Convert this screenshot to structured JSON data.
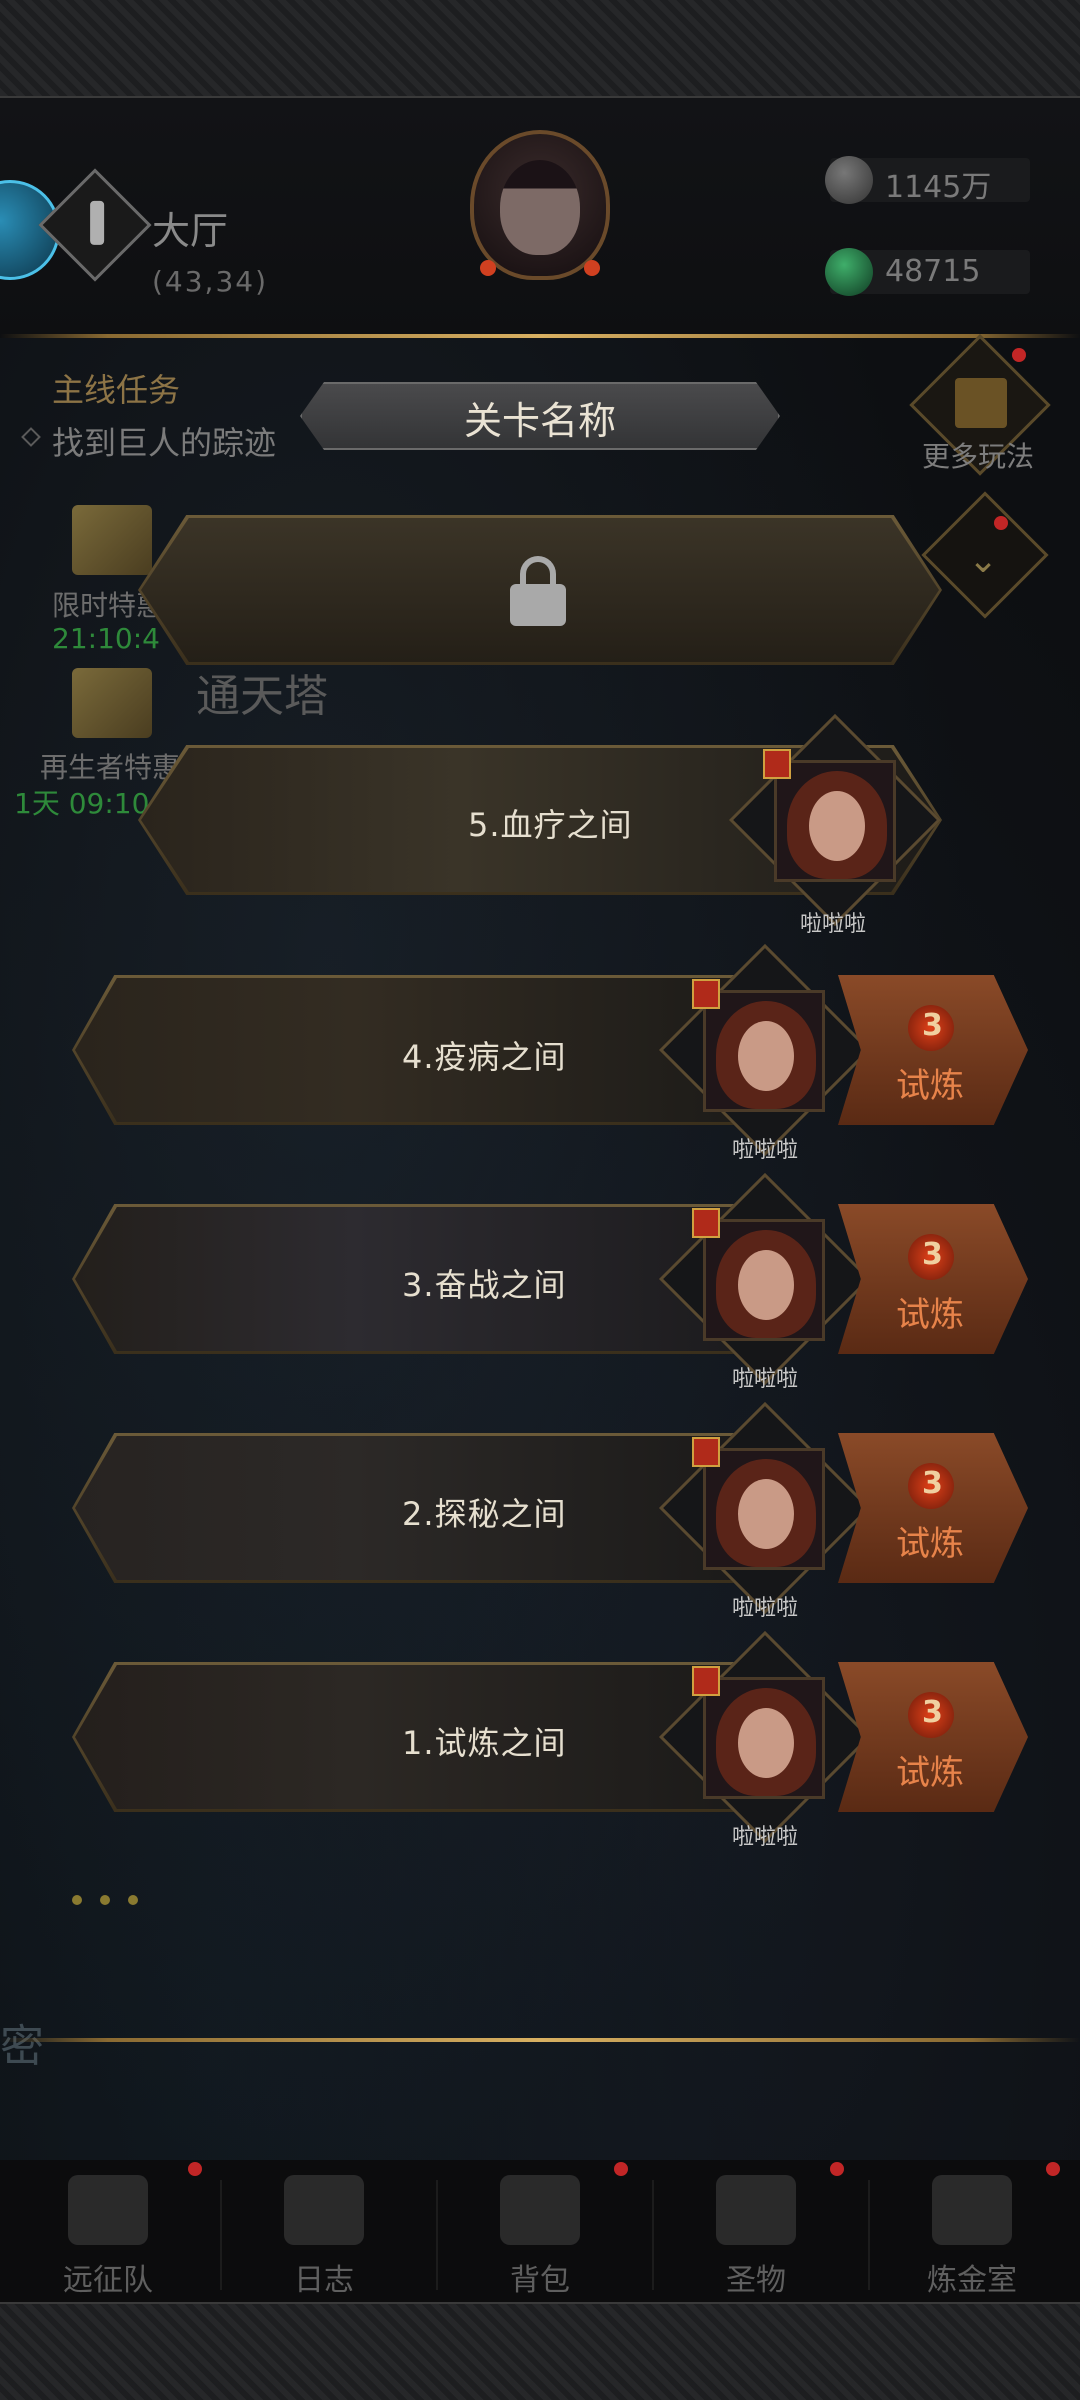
{
  "header": {
    "location_name": "大厅",
    "location_coord": "(43,34)",
    "resources": [
      {
        "icon": "ore-icon",
        "value": "1145万"
      },
      {
        "icon": "emerald-icon",
        "value": "48715"
      }
    ]
  },
  "quest": {
    "title": "主线任务",
    "desc": "找到巨人的踪迹"
  },
  "stage_panel": {
    "title": "关卡名称"
  },
  "side": {
    "more_play": "更多玩法"
  },
  "events": [
    {
      "label": "限时特惠",
      "timer": "21:10:4"
    },
    {
      "label": "再生者特惠",
      "timer": "1天 09:10"
    }
  ],
  "tower_label": "通天塔",
  "stages": [
    {
      "name": "5.血疗之间",
      "host": "啦啦啦"
    },
    {
      "name": "4.疫病之间",
      "host": "啦啦啦",
      "trial_label": "试炼",
      "trial_count": "3"
    },
    {
      "name": "3.奋战之间",
      "host": "啦啦啦",
      "trial_label": "试炼",
      "trial_count": "3"
    },
    {
      "name": "2.探秘之间",
      "host": "啦啦啦",
      "trial_label": "试炼",
      "trial_count": "3"
    },
    {
      "name": "1.试炼之间",
      "host": "啦啦啦",
      "trial_label": "试炼",
      "trial_count": "3"
    }
  ],
  "secret_label": "密",
  "nav": [
    {
      "label": "远征队",
      "icon": "viking-helmet-icon"
    },
    {
      "label": "日志",
      "icon": "scroll-icon"
    },
    {
      "label": "背包",
      "icon": "backpack-icon"
    },
    {
      "label": "圣物",
      "icon": "chalice-icon"
    },
    {
      "label": "炼金室",
      "icon": "alchemy-icon"
    }
  ],
  "colors": {
    "gold": "#d8b062",
    "trial": "#e7834a",
    "timer": "#2e8a3a"
  }
}
